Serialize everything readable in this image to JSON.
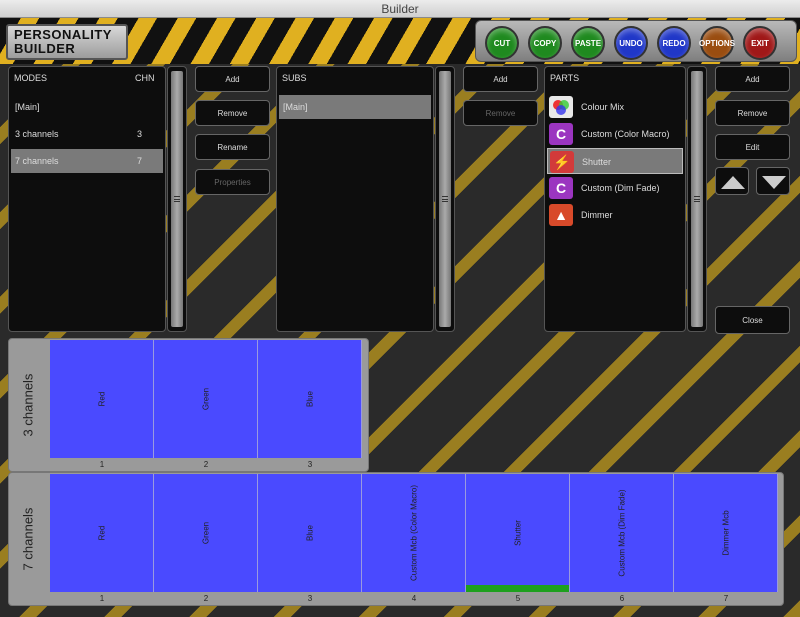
{
  "window": {
    "title": "Builder"
  },
  "logo": {
    "line1": "PERSONALITY",
    "line2": "BUILDER"
  },
  "toolbar": [
    {
      "label": "CUT",
      "color": "#1f8a1f"
    },
    {
      "label": "COPY",
      "color": "#1f8a1f"
    },
    {
      "label": "PASTE",
      "color": "#1f8a1f"
    },
    {
      "label": "UNDO",
      "color": "#2037c8"
    },
    {
      "label": "REDO",
      "color": "#2037c8"
    },
    {
      "label": "OPTIONS",
      "color": "#9a4d10"
    },
    {
      "label": "EXIT",
      "color": "#a01818"
    }
  ],
  "modes": {
    "header": "MODES",
    "chn_header": "CHN",
    "items": [
      {
        "name": "[Main]",
        "chn": ""
      },
      {
        "name": "3 channels",
        "chn": "3"
      },
      {
        "name": "7 channels",
        "chn": "7",
        "selected": true
      }
    ],
    "buttons": {
      "add": "Add",
      "remove": "Remove",
      "rename": "Rename",
      "properties": "Properties"
    }
  },
  "subs": {
    "header": "SUBS",
    "items": [
      {
        "name": "[Main]",
        "selected": true
      }
    ],
    "buttons": {
      "add": "Add",
      "remove": "Remove"
    }
  },
  "parts": {
    "header": "PARTS",
    "items": [
      {
        "name": "Colour Mix",
        "icon": "colour-mix-icon",
        "glyph": "",
        "bg": "#e8e8e8"
      },
      {
        "name": "Custom (Color Macro)",
        "icon": "custom-macro-icon",
        "glyph": "C",
        "bg": "#9b35c0"
      },
      {
        "name": "Shutter",
        "icon": "shutter-icon",
        "glyph": "⚡",
        "bg": "#d23a3a",
        "selected": true
      },
      {
        "name": "Custom (Dim Fade)",
        "icon": "custom-macro-icon",
        "glyph": "C",
        "bg": "#9b35c0"
      },
      {
        "name": "Dimmer",
        "icon": "dimmer-icon",
        "glyph": "▲",
        "bg": "#d84a2a"
      }
    ],
    "buttons": {
      "add": "Add",
      "remove": "Remove",
      "edit": "Edit",
      "close": "Close"
    }
  },
  "mode_views": [
    {
      "label": "3 channels",
      "channels": [
        {
          "name": "Red",
          "num": "1"
        },
        {
          "name": "Green",
          "num": "2"
        },
        {
          "name": "Blue",
          "num": "3"
        }
      ]
    },
    {
      "label": "7 channels",
      "channels": [
        {
          "name": "Red",
          "num": "1"
        },
        {
          "name": "Green",
          "num": "2"
        },
        {
          "name": "Blue",
          "num": "3"
        },
        {
          "name": "Custom Mcb (Color Macro)",
          "num": "4"
        },
        {
          "name": "Shutter",
          "num": "5",
          "active": true
        },
        {
          "name": "Custom Mcb (Dim Fade)",
          "num": "6"
        },
        {
          "name": "Dimmer Mcb",
          "num": "7"
        }
      ]
    }
  ]
}
